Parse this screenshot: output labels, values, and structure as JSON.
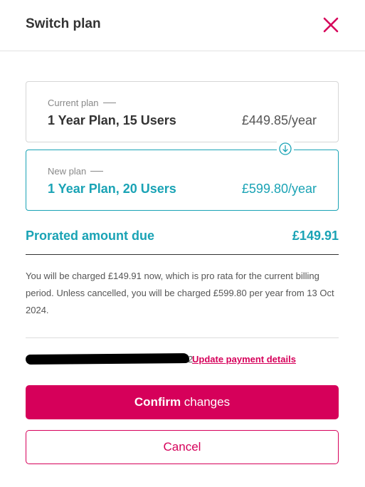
{
  "dialog": {
    "title": "Switch plan"
  },
  "current_plan": {
    "kicker": "Current plan",
    "name": "1 Year Plan, 15 Users",
    "price": "£449.85/year"
  },
  "new_plan": {
    "kicker": "New plan",
    "name": "1 Year Plan, 20 Users",
    "price": "£599.80/year"
  },
  "prorated": {
    "label": "Prorated amount due",
    "value": "£149.91"
  },
  "notice": "You will be charged £149.91 now, which is pro rata for the current billing period. Unless cancelled, you will be charged £599.80 per year from 13 Oct 2024.",
  "payment": {
    "suffix": "2.",
    "update_link": "Update payment details"
  },
  "buttons": {
    "confirm_strong": "Confirm",
    "confirm_rest": " changes",
    "cancel": "Cancel"
  },
  "colors": {
    "accent": "#d6005a",
    "teal": "#1aa3b5",
    "text": "#333333"
  },
  "icons": {
    "close": "close-icon",
    "arrow": "arrow-down-circle-icon"
  }
}
